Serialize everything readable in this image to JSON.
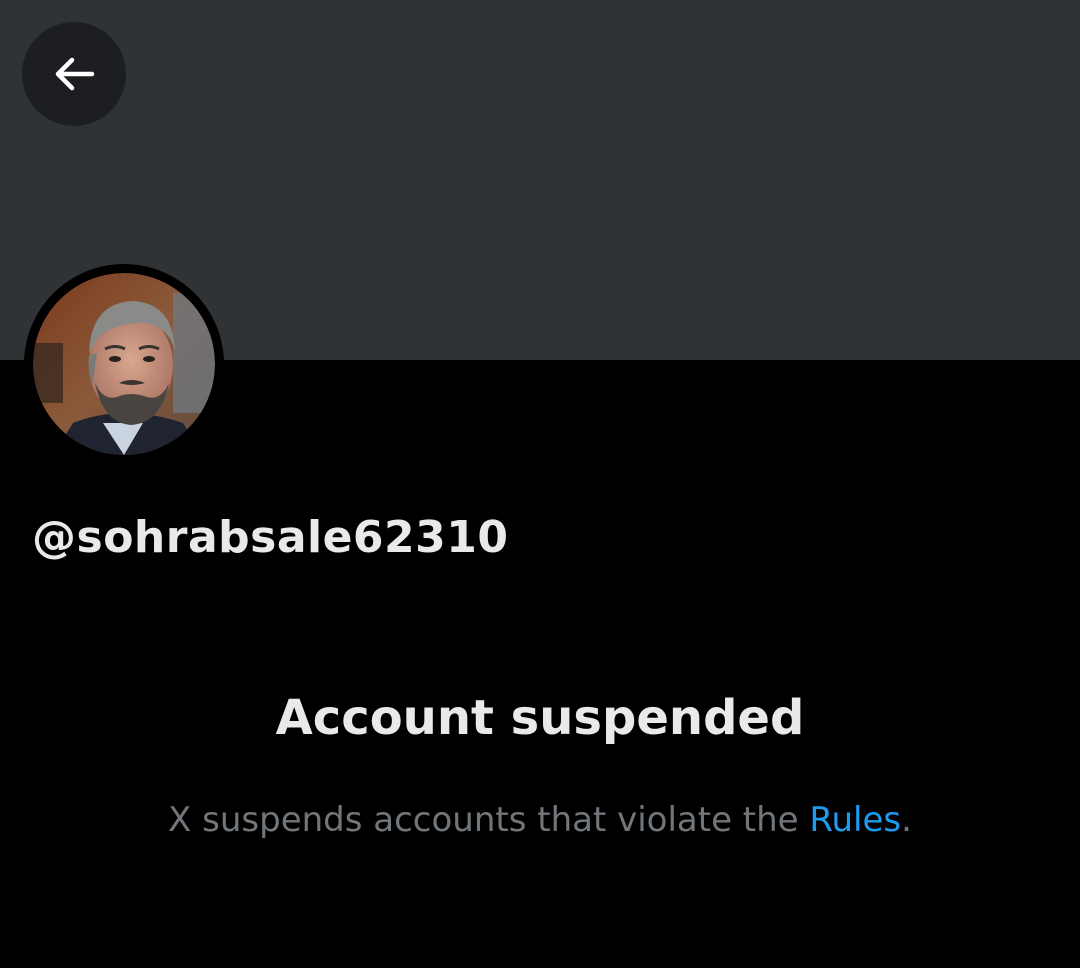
{
  "header": {
    "back_icon": "arrow-left-icon",
    "banner_color": "#2f3336"
  },
  "profile": {
    "avatar_description": "profile photo",
    "handle": "@sohrabsale62310"
  },
  "suspension": {
    "title": "Account suspended",
    "message_prefix": "X suspends accounts that violate the ",
    "rules_link": "Rules",
    "message_suffix": "."
  },
  "colors": {
    "background": "#000000",
    "primary_text": "#e7e9ea",
    "secondary_text": "#71767b",
    "link": "#1d9bf0"
  }
}
